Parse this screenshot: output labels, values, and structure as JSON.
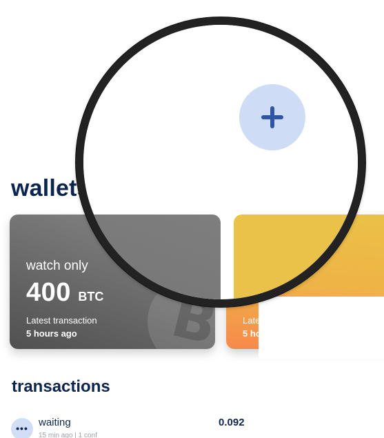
{
  "wallets": {
    "heading": "wallets",
    "cards": [
      {
        "label": "watch only",
        "balance": "400",
        "unit": "BTC",
        "latest_label": "Latest transaction",
        "latest_value": "5 hours ago",
        "theme": "gray"
      },
      {
        "label": "",
        "latest_label": "Late",
        "latest_value": "5 ho",
        "theme": "gold"
      }
    ]
  },
  "transactions": {
    "heading": "transactions",
    "rows": [
      {
        "status": "waiting",
        "meta": "15 min ago | 1 conf",
        "amount": "0.092",
        "icon": "ellipsis-icon"
      }
    ]
  },
  "magnifier": {
    "add_icon": "plus-icon"
  },
  "colors": {
    "heading": "#0c2550",
    "add_button_bg": "#cfdcf6",
    "add_icon": "#2f56a6",
    "card_gray": "#6a6a6a",
    "card_gold": "#eac247",
    "card_orange": "#f7884b"
  }
}
